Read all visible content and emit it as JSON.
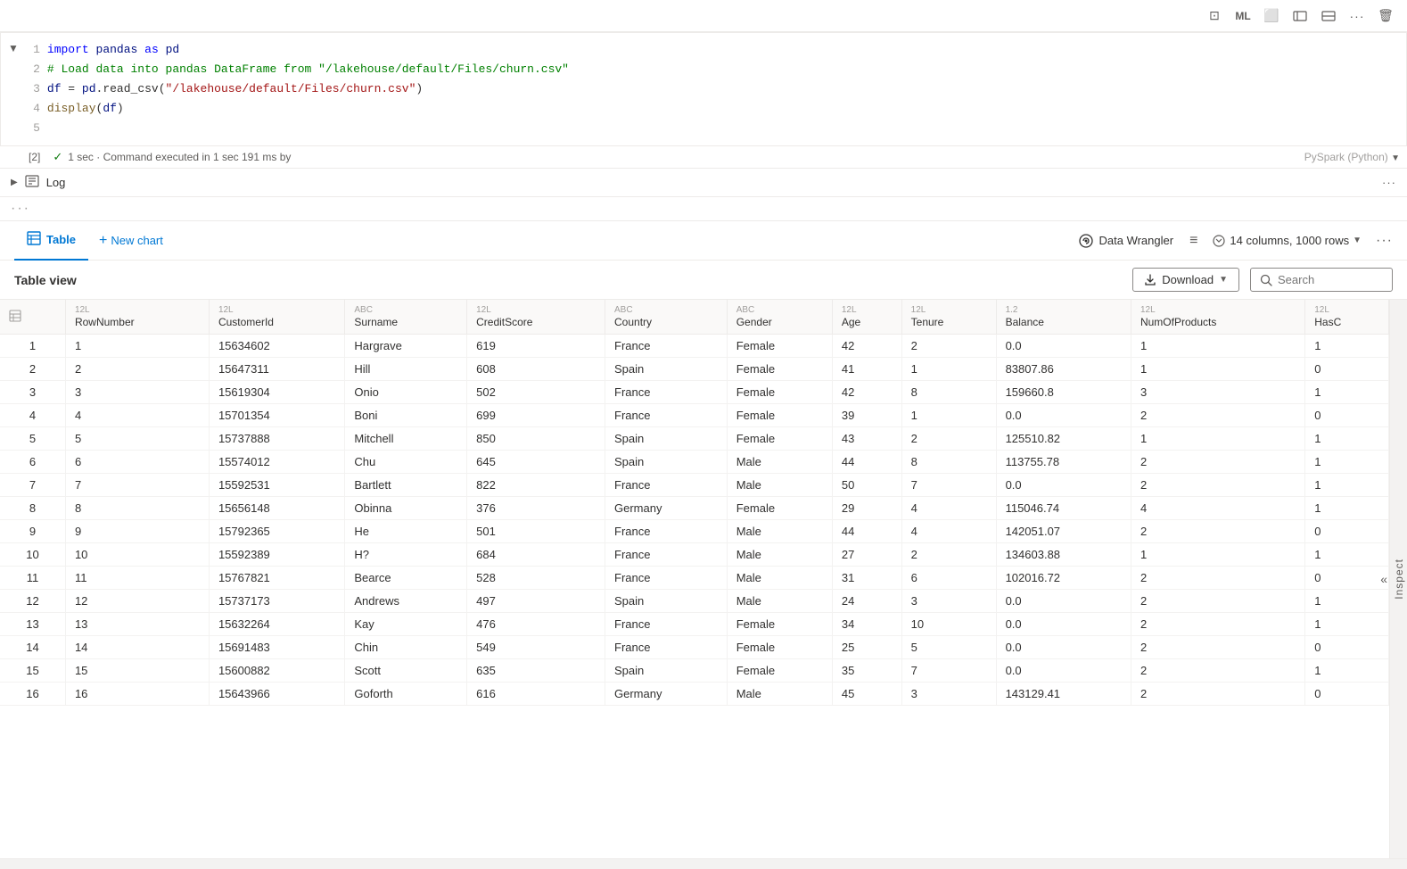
{
  "toolbar": {
    "icons": [
      "⊡",
      "Mℓ",
      "⬜",
      "⬡",
      "⬡",
      "···",
      "🗑"
    ]
  },
  "code_cell": {
    "cell_number": "[2]",
    "lines": [
      {
        "num": 1,
        "parts": [
          {
            "text": "import ",
            "class": "kw-import"
          },
          {
            "text": "pandas",
            "class": "var"
          },
          {
            "text": " as ",
            "class": "kw"
          },
          {
            "text": "pd",
            "class": "var"
          }
        ]
      },
      {
        "num": 2,
        "parts": [
          {
            "text": "# Load data into pandas DataFrame from \"/lakehouse/default/Files/churn.csv\"",
            "class": "comment"
          }
        ]
      },
      {
        "num": 3,
        "parts": [
          {
            "text": "df",
            "class": "var"
          },
          {
            "text": " = ",
            "class": "code"
          },
          {
            "text": "pd",
            "class": "var"
          },
          {
            "text": ".read_csv(",
            "class": "code"
          },
          {
            "text": "\"/lakehouse/default/Files/churn.csv\"",
            "class": "str"
          },
          {
            "text": ")",
            "class": "code"
          }
        ]
      },
      {
        "num": 4,
        "parts": [
          {
            "text": "display",
            "class": "fn"
          },
          {
            "text": "(",
            "class": "code"
          },
          {
            "text": "df",
            "class": "var"
          },
          {
            "text": ")",
            "class": "code"
          }
        ]
      },
      {
        "num": 5,
        "parts": [
          {
            "text": "",
            "class": "code"
          }
        ]
      }
    ],
    "exec_status": "✓",
    "exec_time": "1 sec · Command executed in 1 sec 191 ms by",
    "spark_label": "PySpark (Python)",
    "log_label": "Log"
  },
  "tabs": {
    "table_label": "Table",
    "new_chart_label": "New chart",
    "data_wrangler_label": "Data Wrangler",
    "columns_label": "14 columns, 1000 rows",
    "filter_icon": "≡"
  },
  "table": {
    "title": "Table view",
    "download_label": "Download",
    "search_placeholder": "Search",
    "columns": [
      {
        "type": "12L",
        "name": "RowNumber"
      },
      {
        "type": "12L",
        "name": "CustomerId"
      },
      {
        "type": "ABC",
        "name": "Surname"
      },
      {
        "type": "12L",
        "name": "CreditScore"
      },
      {
        "type": "ABC",
        "name": "Country"
      },
      {
        "type": "ABC",
        "name": "Gender"
      },
      {
        "type": "12L",
        "name": "Age"
      },
      {
        "type": "12L",
        "name": "Tenure"
      },
      {
        "type": "1.2",
        "name": "Balance"
      },
      {
        "type": "12L",
        "name": "NumOfProducts"
      },
      {
        "type": "12L",
        "name": "HasC"
      }
    ],
    "rows": [
      [
        1,
        1,
        15634602,
        "Hargrave",
        619,
        "France",
        "Female",
        42,
        2,
        "0.0",
        1,
        1
      ],
      [
        2,
        2,
        15647311,
        "Hill",
        608,
        "Spain",
        "Female",
        41,
        1,
        "83807.86",
        1,
        0
      ],
      [
        3,
        3,
        15619304,
        "Onio",
        502,
        "France",
        "Female",
        42,
        8,
        "159660.8",
        3,
        1
      ],
      [
        4,
        4,
        15701354,
        "Boni",
        699,
        "France",
        "Female",
        39,
        1,
        "0.0",
        2,
        0
      ],
      [
        5,
        5,
        15737888,
        "Mitchell",
        850,
        "Spain",
        "Female",
        43,
        2,
        "125510.82",
        1,
        1
      ],
      [
        6,
        6,
        15574012,
        "Chu",
        645,
        "Spain",
        "Male",
        44,
        8,
        "113755.78",
        2,
        1
      ],
      [
        7,
        7,
        15592531,
        "Bartlett",
        822,
        "France",
        "Male",
        50,
        7,
        "0.0",
        2,
        1
      ],
      [
        8,
        8,
        15656148,
        "Obinna",
        376,
        "Germany",
        "Female",
        29,
        4,
        "115046.74",
        4,
        1
      ],
      [
        9,
        9,
        15792365,
        "He",
        501,
        "France",
        "Male",
        44,
        4,
        "142051.07",
        2,
        0
      ],
      [
        10,
        10,
        15592389,
        "H?",
        684,
        "France",
        "Male",
        27,
        2,
        "134603.88",
        1,
        1
      ],
      [
        11,
        11,
        15767821,
        "Bearce",
        528,
        "France",
        "Male",
        31,
        6,
        "102016.72",
        2,
        0
      ],
      [
        12,
        12,
        15737173,
        "Andrews",
        497,
        "Spain",
        "Male",
        24,
        3,
        "0.0",
        2,
        1
      ],
      [
        13,
        13,
        15632264,
        "Kay",
        476,
        "France",
        "Female",
        34,
        10,
        "0.0",
        2,
        1
      ],
      [
        14,
        14,
        15691483,
        "Chin",
        549,
        "France",
        "Female",
        25,
        5,
        "0.0",
        2,
        0
      ],
      [
        15,
        15,
        15600882,
        "Scott",
        635,
        "Spain",
        "Female",
        35,
        7,
        "0.0",
        2,
        1
      ],
      [
        16,
        16,
        15643966,
        "Goforth",
        616,
        "Germany",
        "Male",
        45,
        3,
        "143129.41",
        2,
        0
      ]
    ]
  }
}
